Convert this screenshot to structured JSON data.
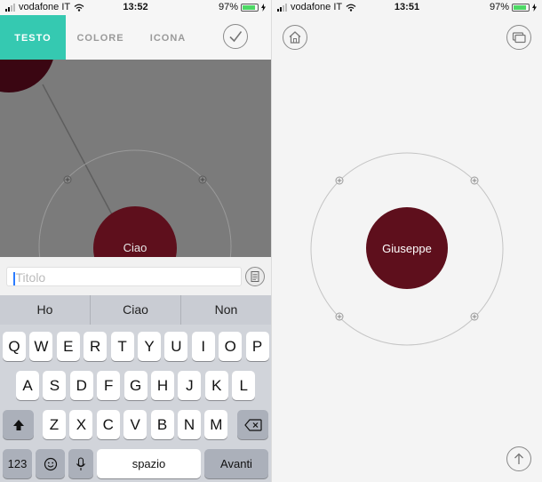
{
  "left_screen": {
    "status": {
      "carrier": "vodafone IT",
      "time": "13:52",
      "battery": "97%"
    },
    "tabs": [
      {
        "label": "TESTO",
        "active": true
      },
      {
        "label": "COLORE",
        "active": false
      },
      {
        "label": "ICONA",
        "active": false
      }
    ],
    "canvas": {
      "node_label": "Ciao",
      "node_color": "#5e0f1c"
    },
    "input": {
      "placeholder": "Titolo",
      "value": ""
    },
    "keyboard": {
      "suggestions": [
        "Ho",
        "Ciao",
        "Non"
      ],
      "rows": [
        [
          "Q",
          "W",
          "E",
          "R",
          "T",
          "Y",
          "U",
          "I",
          "O",
          "P"
        ],
        [
          "A",
          "S",
          "D",
          "F",
          "G",
          "H",
          "J",
          "K",
          "L"
        ],
        [
          "Z",
          "X",
          "C",
          "V",
          "B",
          "N",
          "M"
        ]
      ],
      "numbers_key": "123",
      "space_key": "spazio",
      "return_key": "Avanti"
    }
  },
  "right_screen": {
    "status": {
      "carrier": "vodafone IT",
      "time": "13:51",
      "battery": "97%"
    },
    "node": {
      "label": "Giuseppe",
      "color": "#5e0f1c"
    }
  },
  "colors": {
    "accent": "#35c9b1",
    "node": "#5e0f1c",
    "canvas": "#7b7b7b"
  },
  "icons": [
    "signal-icon",
    "wifi-icon",
    "battery-icon",
    "charging-icon",
    "checkmark-icon",
    "home-icon",
    "devices-icon",
    "arrow-up-icon",
    "document-icon",
    "shift-icon",
    "backspace-icon",
    "emoji-icon",
    "microphone-icon",
    "plus-icon"
  ]
}
